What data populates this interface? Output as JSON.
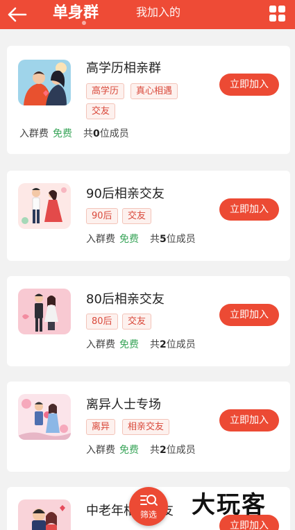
{
  "header": {
    "title": "单身群",
    "tab_joined": "我加入的",
    "back_icon": "arrow-left-icon",
    "menu_icon": "grid-icon"
  },
  "groups": [
    {
      "name": "高学历相亲群",
      "tags": [
        "高学历",
        "真心相遇",
        "交友"
      ],
      "fee_label": "入群费",
      "fee": "免费",
      "count_prefix": "共",
      "count": "0",
      "count_suffix": "位成员",
      "join_label": "立即加入"
    },
    {
      "name": "90后相亲交友",
      "tags": [
        "90后",
        "交友"
      ],
      "fee_label": "入群费",
      "fee": "免费",
      "count_prefix": "共",
      "count": "5",
      "count_suffix": "位成员",
      "join_label": "立即加入"
    },
    {
      "name": "80后相亲交友",
      "tags": [
        "80后",
        "交友"
      ],
      "fee_label": "入群费",
      "fee": "免费",
      "count_prefix": "共",
      "count": "2",
      "count_suffix": "位成员",
      "join_label": "立即加入"
    },
    {
      "name": "离异人士专场",
      "tags": [
        "离异",
        "相亲交友"
      ],
      "fee_label": "入群费",
      "fee": "免费",
      "count_prefix": "共",
      "count": "2",
      "count_suffix": "位成员",
      "join_label": "立即加入"
    },
    {
      "name": "中老年相亲交友",
      "join_label": "立即加入"
    }
  ],
  "filter": {
    "label": "筛选",
    "icon": "filter-search-icon"
  },
  "watermark": "大玩客",
  "colors": {
    "accent": "#ee4b36",
    "free": "#3aa55a"
  }
}
